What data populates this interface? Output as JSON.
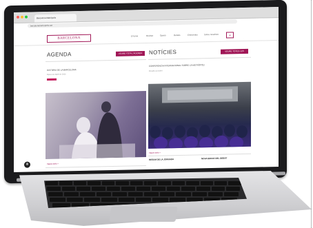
{
  "browser": {
    "tab_title": "Barcelona Metròpolis",
    "address": "barcelonametropolis.cat"
  },
  "site": {
    "logo_text": "BARCELONA",
    "nav": [
      "El tema",
      "Revista",
      "Opinió",
      "Debats",
      "Entrevistes",
      "Sobre nosaltres"
    ],
    "nav_button": "≡"
  },
  "agenda": {
    "title": "AGENDA",
    "button": "VEURE TOTA L'AGENDA",
    "item_title": "HISTÒRIA DE LA BARCELONA",
    "item_meta": "Dijous 14 d'abril de 2023",
    "more_link": "Veure més +"
  },
  "noticies": {
    "title": "NOTÍCIES",
    "button": "VEURE TOTES LES",
    "headline": "CONFERÈNCIA INTERNACIONAL SOBRE LA METRÒPOLI",
    "meta": "Dimarts 12 d'abril",
    "more_link": "Veure més +",
    "bottom_left": "RESUM DE LA JORNADA",
    "bottom_right": "NOVA EDICIÓ DEL DEBAT"
  },
  "colors": {
    "accent": "#a01656",
    "laptop_bezel": "#1b1b1d"
  }
}
